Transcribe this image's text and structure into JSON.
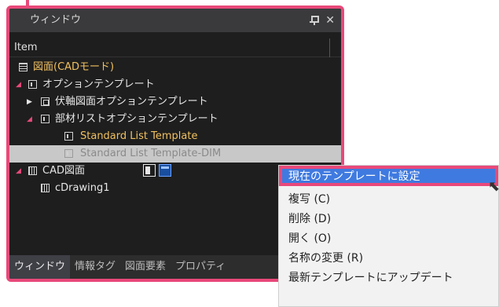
{
  "panel": {
    "title": "ウィンドウ",
    "column_header": "Item",
    "tree": [
      {
        "label": "図面(CADモード)"
      },
      {
        "label": "オプションテンプレート"
      },
      {
        "label": "伏軸図面オプションテンプレート"
      },
      {
        "label": "部材リストオプションテンプレート"
      },
      {
        "label": "Standard List Template"
      },
      {
        "label": "Standard List Template-DIM"
      },
      {
        "label": "CAD図面"
      },
      {
        "label": "cDrawing1"
      }
    ],
    "tabs": [
      "ウィンドウ",
      "情報タグ",
      "図面要素",
      "プロパティ"
    ]
  },
  "context_menu": {
    "items": [
      "現在のテンプレートに設定",
      "複写 (C)",
      "削除 (D)",
      "開く (O)",
      "名称の変更 (R)",
      "最新テンプレートにアップデート"
    ]
  },
  "colors": {
    "highlight_border": "#e8497a",
    "menu_selection": "#3f7ae0",
    "template_text": "#f0c060"
  }
}
